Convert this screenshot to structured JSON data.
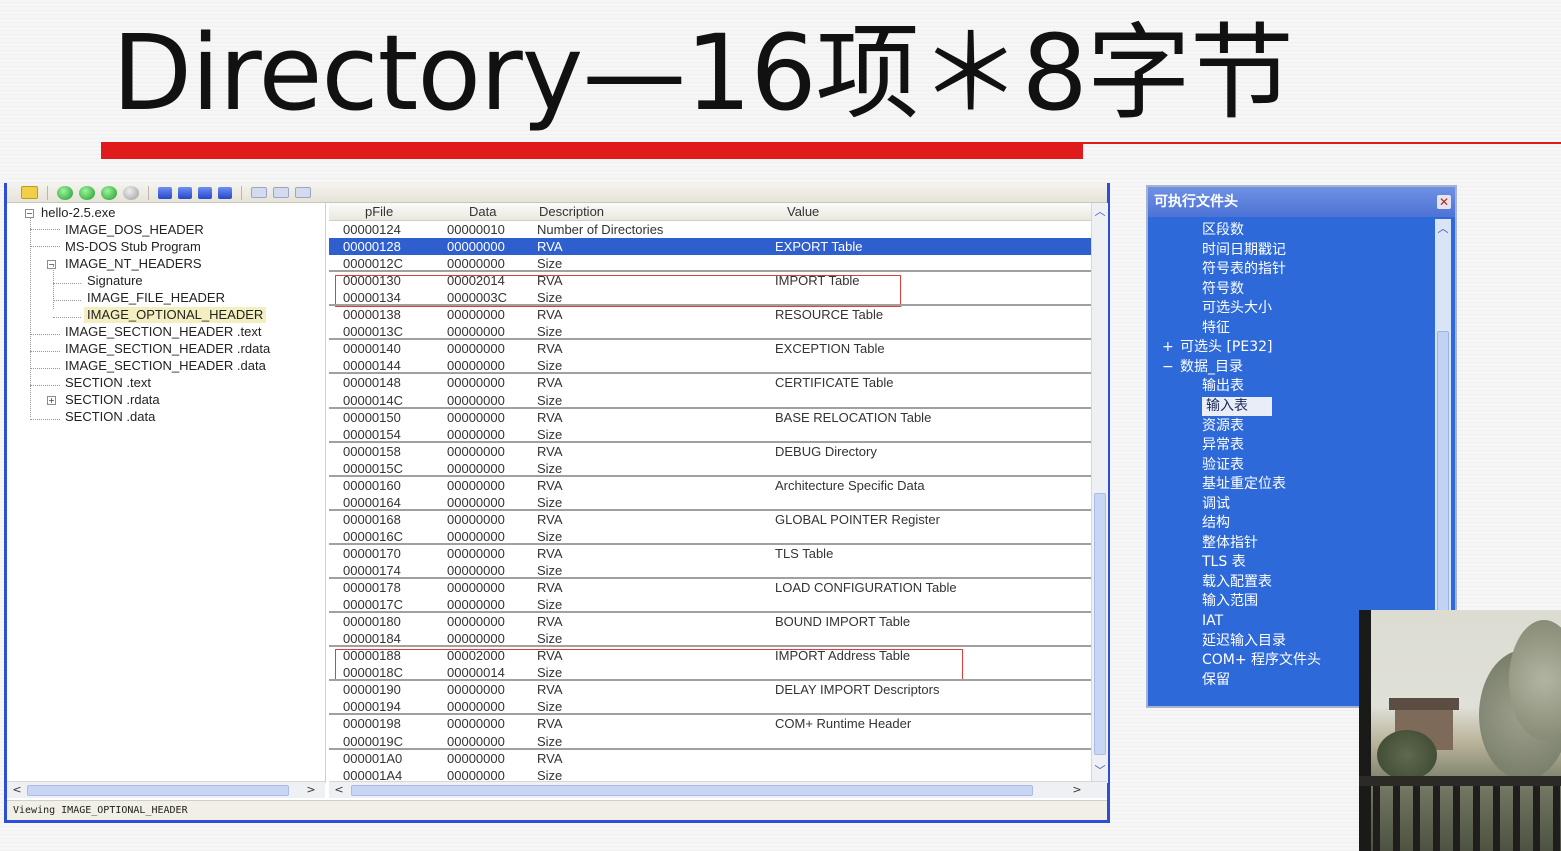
{
  "title": "Directory—16项＊8字节",
  "colors": {
    "accent_red": "#e01b1b",
    "window_border": "#2b4fd6",
    "selection": "#2f5fce",
    "panel_blue": "#2e69d9"
  },
  "toolbar_icons": [
    "folder-open-icon",
    "green-nav-icon",
    "green-nav-icon",
    "green-nav-icon",
    "gray-nav-icon",
    "blue-window-icon",
    "blue-window-icon",
    "blue-arrow-icon",
    "blue-arrow-icon",
    "light-icon",
    "light-icon",
    "light-icon"
  ],
  "tree": {
    "root": "hello-2.5.exe",
    "items": [
      {
        "label": "IMAGE_DOS_HEADER"
      },
      {
        "label": "MS-DOS Stub Program"
      },
      {
        "label": "IMAGE_NT_HEADERS"
      },
      {
        "label": "Signature"
      },
      {
        "label": "IMAGE_FILE_HEADER"
      },
      {
        "label": "IMAGE_OPTIONAL_HEADER"
      },
      {
        "label": "IMAGE_SECTION_HEADER .text"
      },
      {
        "label": "IMAGE_SECTION_HEADER .rdata"
      },
      {
        "label": "IMAGE_SECTION_HEADER .data"
      },
      {
        "label": "SECTION .text"
      },
      {
        "label": "SECTION .rdata"
      },
      {
        "label": "SECTION .data"
      }
    ]
  },
  "grid": {
    "columns": [
      "pFile",
      "Data",
      "Description",
      "Value"
    ],
    "rows": [
      {
        "pfile": "00000124",
        "data": "00000010",
        "desc": "Number of Directories",
        "value": ""
      },
      {
        "pfile": "00000128",
        "data": "00000000",
        "desc": "RVA",
        "value": "EXPORT Table"
      },
      {
        "pfile": "0000012C",
        "data": "00000000",
        "desc": "Size",
        "value": ""
      },
      {
        "pfile": "00000130",
        "data": "00002014",
        "desc": "RVA",
        "value": "IMPORT Table"
      },
      {
        "pfile": "00000134",
        "data": "0000003C",
        "desc": "Size",
        "value": ""
      },
      {
        "pfile": "00000138",
        "data": "00000000",
        "desc": "RVA",
        "value": "RESOURCE Table"
      },
      {
        "pfile": "0000013C",
        "data": "00000000",
        "desc": "Size",
        "value": ""
      },
      {
        "pfile": "00000140",
        "data": "00000000",
        "desc": "RVA",
        "value": "EXCEPTION Table"
      },
      {
        "pfile": "00000144",
        "data": "00000000",
        "desc": "Size",
        "value": ""
      },
      {
        "pfile": "00000148",
        "data": "00000000",
        "desc": "RVA",
        "value": "CERTIFICATE Table"
      },
      {
        "pfile": "0000014C",
        "data": "00000000",
        "desc": "Size",
        "value": ""
      },
      {
        "pfile": "00000150",
        "data": "00000000",
        "desc": "RVA",
        "value": "BASE RELOCATION Table"
      },
      {
        "pfile": "00000154",
        "data": "00000000",
        "desc": "Size",
        "value": ""
      },
      {
        "pfile": "00000158",
        "data": "00000000",
        "desc": "RVA",
        "value": "DEBUG Directory"
      },
      {
        "pfile": "0000015C",
        "data": "00000000",
        "desc": "Size",
        "value": ""
      },
      {
        "pfile": "00000160",
        "data": "00000000",
        "desc": "RVA",
        "value": "Architecture Specific Data"
      },
      {
        "pfile": "00000164",
        "data": "00000000",
        "desc": "Size",
        "value": ""
      },
      {
        "pfile": "00000168",
        "data": "00000000",
        "desc": "RVA",
        "value": "GLOBAL POINTER Register"
      },
      {
        "pfile": "0000016C",
        "data": "00000000",
        "desc": "Size",
        "value": ""
      },
      {
        "pfile": "00000170",
        "data": "00000000",
        "desc": "RVA",
        "value": "TLS Table"
      },
      {
        "pfile": "00000174",
        "data": "00000000",
        "desc": "Size",
        "value": ""
      },
      {
        "pfile": "00000178",
        "data": "00000000",
        "desc": "RVA",
        "value": "LOAD CONFIGURATION Table"
      },
      {
        "pfile": "0000017C",
        "data": "00000000",
        "desc": "Size",
        "value": ""
      },
      {
        "pfile": "00000180",
        "data": "00000000",
        "desc": "RVA",
        "value": "BOUND IMPORT Table"
      },
      {
        "pfile": "00000184",
        "data": "00000000",
        "desc": "Size",
        "value": ""
      },
      {
        "pfile": "00000188",
        "data": "00002000",
        "desc": "RVA",
        "value": "IMPORT Address Table"
      },
      {
        "pfile": "0000018C",
        "data": "00000014",
        "desc": "Size",
        "value": ""
      },
      {
        "pfile": "00000190",
        "data": "00000000",
        "desc": "RVA",
        "value": "DELAY IMPORT Descriptors"
      },
      {
        "pfile": "00000194",
        "data": "00000000",
        "desc": "Size",
        "value": ""
      },
      {
        "pfile": "00000198",
        "data": "00000000",
        "desc": "RVA",
        "value": "COM+ Runtime Header"
      },
      {
        "pfile": "0000019C",
        "data": "00000000",
        "desc": "Size",
        "value": ""
      },
      {
        "pfile": "000001A0",
        "data": "00000000",
        "desc": "RVA",
        "value": ""
      },
      {
        "pfile": "000001A4",
        "data": "00000000",
        "desc": "Size",
        "value": ""
      }
    ]
  },
  "status": "Viewing IMAGE_OPTIONAL_HEADER",
  "cn_panel": {
    "title": "可执行文件头",
    "items": [
      {
        "label": "区段数",
        "expander": ""
      },
      {
        "label": "时间日期戳记",
        "expander": ""
      },
      {
        "label": "符号表的指针",
        "expander": ""
      },
      {
        "label": "符号数",
        "expander": ""
      },
      {
        "label": "可选头大小",
        "expander": ""
      },
      {
        "label": "特征",
        "expander": ""
      },
      {
        "label": "可选头 [PE32]",
        "expander": "+"
      },
      {
        "label": "数据_目录",
        "expander": "-"
      },
      {
        "label": "输出表",
        "expander": ""
      },
      {
        "label": "输入表",
        "expander": ""
      },
      {
        "label": "资源表",
        "expander": ""
      },
      {
        "label": "异常表",
        "expander": ""
      },
      {
        "label": "验证表",
        "expander": ""
      },
      {
        "label": "基址重定位表",
        "expander": ""
      },
      {
        "label": "调试",
        "expander": ""
      },
      {
        "label": "结构",
        "expander": ""
      },
      {
        "label": "整体指针",
        "expander": ""
      },
      {
        "label": "TLS 表",
        "expander": ""
      },
      {
        "label": "载入配置表",
        "expander": ""
      },
      {
        "label": "输入范围",
        "expander": ""
      },
      {
        "label": "IAT",
        "expander": ""
      },
      {
        "label": "延迟输入目录",
        "expander": ""
      },
      {
        "label": "COM+ 程序文件头",
        "expander": ""
      },
      {
        "label": "保留",
        "expander": ""
      }
    ],
    "close_icon": "close-icon"
  }
}
